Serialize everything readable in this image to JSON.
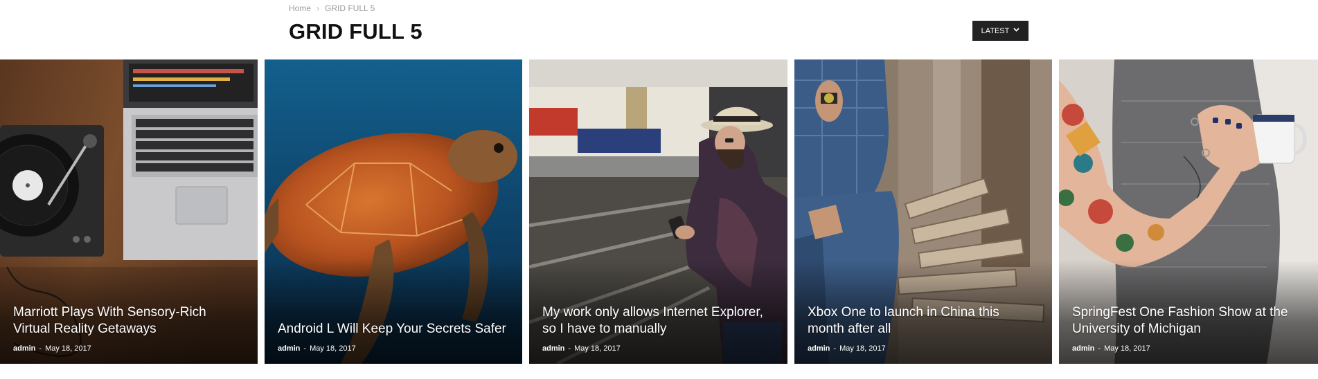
{
  "breadcrumb": {
    "home": "Home",
    "separator": "›",
    "current": "GRID FULL 5"
  },
  "page_title": "GRID FULL 5",
  "sort": {
    "label": "LATEST",
    "icon": "chevron-down-icon"
  },
  "posts": [
    {
      "title": "Marriott Plays With Sensory-Rich Virtual Reality Getaways",
      "author": "admin",
      "date": "May 18, 2017",
      "image": "turntable and laptop on wooden desk"
    },
    {
      "title": "Android L Will Keep Your Secrets Safer",
      "author": "admin",
      "date": "May 18, 2017",
      "image": "sea turtle swimming in blue water"
    },
    {
      "title": "My work only allows Internet Explorer, so I have to manually",
      "author": "admin",
      "date": "May 18, 2017",
      "image": "man with hat checking phone at train station"
    },
    {
      "title": "Xbox One to launch in China this month after all",
      "author": "admin",
      "date": "May 18, 2017",
      "image": "man in denim sitting near woodpile"
    },
    {
      "title": "SpringFest One Fashion Show at the University of Michigan",
      "author": "admin",
      "date": "May 18, 2017",
      "image": "tattooed woman holding a mug"
    }
  ],
  "byline_separator": "-",
  "colors": {
    "title": "#111111",
    "button_bg": "#222222",
    "breadcrumb": "#9a9a9a",
    "overlay_text": "#ffffff"
  }
}
